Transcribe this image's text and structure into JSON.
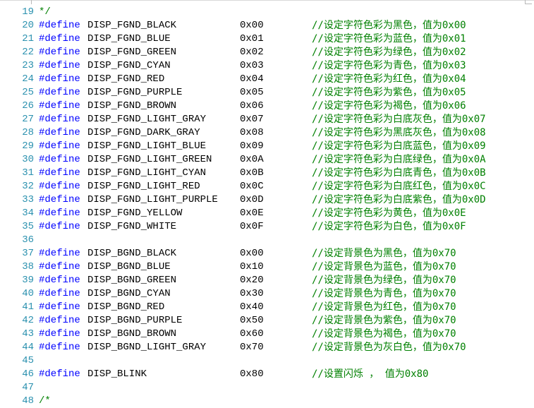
{
  "lines": [
    {
      "n": "19",
      "kind": "comment",
      "text": "*/"
    },
    {
      "n": "20",
      "kind": "define",
      "name": "DISP_FGND_BLACK",
      "value": "0x00",
      "comment": "//设定字符色彩为黑色，值为0x00"
    },
    {
      "n": "21",
      "kind": "define",
      "name": "DISP_FGND_BLUE",
      "value": "0x01",
      "comment": "//设定字符色彩为蓝色，值为0x01"
    },
    {
      "n": "22",
      "kind": "define",
      "name": "DISP_FGND_GREEN",
      "value": "0x02",
      "comment": "//设定字符色彩为绿色，值为0x02"
    },
    {
      "n": "23",
      "kind": "define",
      "name": "DISP_FGND_CYAN",
      "value": "0x03",
      "comment": "//设定字符色彩为青色，值为0x03"
    },
    {
      "n": "24",
      "kind": "define",
      "name": "DISP_FGND_RED",
      "value": "0x04",
      "comment": "//设定字符色彩为红色，值为0x04"
    },
    {
      "n": "25",
      "kind": "define",
      "name": "DISP_FGND_PURPLE",
      "value": "0x05",
      "comment": "//设定字符色彩为紫色，值为0x05"
    },
    {
      "n": "26",
      "kind": "define",
      "name": "DISP_FGND_BROWN",
      "value": "0x06",
      "comment": "//设定字符色彩为褐色，值为0x06"
    },
    {
      "n": "27",
      "kind": "define",
      "name": "DISP_FGND_LIGHT_GRAY",
      "value": "0x07",
      "comment": "//设定字符色彩为白底灰色，值为0x07"
    },
    {
      "n": "28",
      "kind": "define",
      "name": "DISP_FGND_DARK_GRAY",
      "value": "0x08",
      "comment": "//设定字符色彩为黑底灰色，值为0x08"
    },
    {
      "n": "29",
      "kind": "define",
      "name": "DISP_FGND_LIGHT_BLUE",
      "value": "0x09",
      "comment": "//设定字符色彩为白底蓝色，值为0x09"
    },
    {
      "n": "30",
      "kind": "define",
      "name": "DISP_FGND_LIGHT_GREEN",
      "value": "0x0A",
      "comment": "//设定字符色彩为白底绿色，值为0x0A"
    },
    {
      "n": "31",
      "kind": "define",
      "name": "DISP_FGND_LIGHT_CYAN",
      "value": "0x0B",
      "comment": "//设定字符色彩为白底青色，值为0x0B"
    },
    {
      "n": "32",
      "kind": "define",
      "name": "DISP_FGND_LIGHT_RED",
      "value": "0x0C",
      "comment": "//设定字符色彩为白底红色，值为0x0C"
    },
    {
      "n": "33",
      "kind": "define",
      "name": "DISP_FGND_LIGHT_PURPLE",
      "value": "0x0D",
      "comment": "//设定字符色彩为白底紫色，值为0x0D"
    },
    {
      "n": "34",
      "kind": "define",
      "name": "DISP_FGND_YELLOW",
      "value": "0x0E",
      "comment": "//设定字符色彩为黄色，值为0x0E"
    },
    {
      "n": "35",
      "kind": "define",
      "name": "DISP_FGND_WHITE",
      "value": "0x0F",
      "comment": "//设定字符色彩为白色，值为0x0F"
    },
    {
      "n": "36",
      "kind": "blank"
    },
    {
      "n": "37",
      "kind": "define",
      "name": "DISP_BGND_BLACK",
      "value": "0x00",
      "comment": "//设定背景色为黑色，值为0x70"
    },
    {
      "n": "38",
      "kind": "define",
      "name": "DISP_BGND_BLUE",
      "value": "0x10",
      "comment": "//设定背景色为蓝色，值为0x70"
    },
    {
      "n": "39",
      "kind": "define",
      "name": "DISP_BGND_GREEN",
      "value": "0x20",
      "comment": "//设定背景色为绿色，值为0x70"
    },
    {
      "n": "40",
      "kind": "define",
      "name": "DISP_BGND_CYAN",
      "value": "0x30",
      "comment": "//设定背景色为青色，值为0x70"
    },
    {
      "n": "41",
      "kind": "define",
      "name": "DISP_BGND_RED",
      "value": "0x40",
      "comment": "//设定背景色为红色，值为0x70"
    },
    {
      "n": "42",
      "kind": "define",
      "name": "DISP_BGND_PURPLE",
      "value": "0x50",
      "comment": "//设定背景色为紫色，值为0x70"
    },
    {
      "n": "43",
      "kind": "define",
      "name": "DISP_BGND_BROWN",
      "value": "0x60",
      "comment": "//设定背景色为褐色，值为0x70"
    },
    {
      "n": "44",
      "kind": "define",
      "name": "DISP_BGND_LIGHT_GRAY",
      "value": "0x70",
      "comment": "//设定背景色为灰白色，值为0x70"
    },
    {
      "n": "45",
      "kind": "blank"
    },
    {
      "n": "46",
      "kind": "define",
      "name": "DISP_BLINK",
      "value": "0x80",
      "comment": "//设置闪烁 ， 值为0x80"
    },
    {
      "n": "47",
      "kind": "blank"
    },
    {
      "n": "48",
      "kind": "comment",
      "text": "/*"
    }
  ],
  "keyword": "#define",
  "colors": {
    "line_number": "#2b91af",
    "keyword": "#0000ff",
    "comment": "#008000",
    "text": "#000000",
    "background": "#ffffff"
  }
}
